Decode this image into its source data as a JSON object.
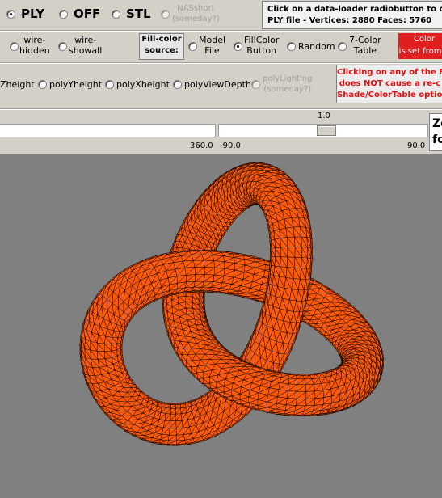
{
  "loader": {
    "options": [
      {
        "label": "PLY",
        "checked": true
      },
      {
        "label": "OFF",
        "checked": false
      },
      {
        "label": "STL",
        "checked": false
      },
      {
        "label": "NASshort\n(someday?)",
        "disabled": true
      }
    ],
    "note_line1": "Click on a data-loader radiobutton to cause",
    "note_line2": "PLY file - Vertices: 2880   Faces: 5760"
  },
  "render_mode": {
    "options": [
      {
        "label": "wire-\nhidden"
      },
      {
        "label": "wire-\nshowall"
      }
    ]
  },
  "fill_color": {
    "source_label": "Fill-color\nsource:",
    "options": [
      {
        "label": "Model\nFile",
        "checked": false
      },
      {
        "label": "FillColor\nButton",
        "checked": true
      },
      {
        "label": "Random",
        "checked": false
      },
      {
        "label": "7-Color\nTable",
        "checked": false
      }
    ],
    "red_note_line1": "Color",
    "red_note_line2": "is set from"
  },
  "shading": {
    "options": [
      {
        "label": "Zheight"
      },
      {
        "label": "polyYheight"
      },
      {
        "label": "polyXheight"
      },
      {
        "label": "polyViewDepth"
      },
      {
        "label": "polyLighting\n(someday?)",
        "disabled": true
      }
    ],
    "red_note_line1": "Clicking on any of the Fill-",
    "red_note_line2": "does NOT cause a re-c",
    "red_note_line3": "Shade/ColorTable option r"
  },
  "sliders": {
    "left_value": "360.0",
    "right_top_value": "1.0",
    "right_min": "-90.0",
    "right_max": "90.0",
    "right_position": 0.5,
    "zoom_label_1": "Zo",
    "zoom_label_2": "fo"
  },
  "colors": {
    "background": "#d4d0c8",
    "viewport": "#808080",
    "mesh_fill": "#ff5a0a",
    "mesh_edge": "#000000",
    "red_note": "#e01010"
  }
}
